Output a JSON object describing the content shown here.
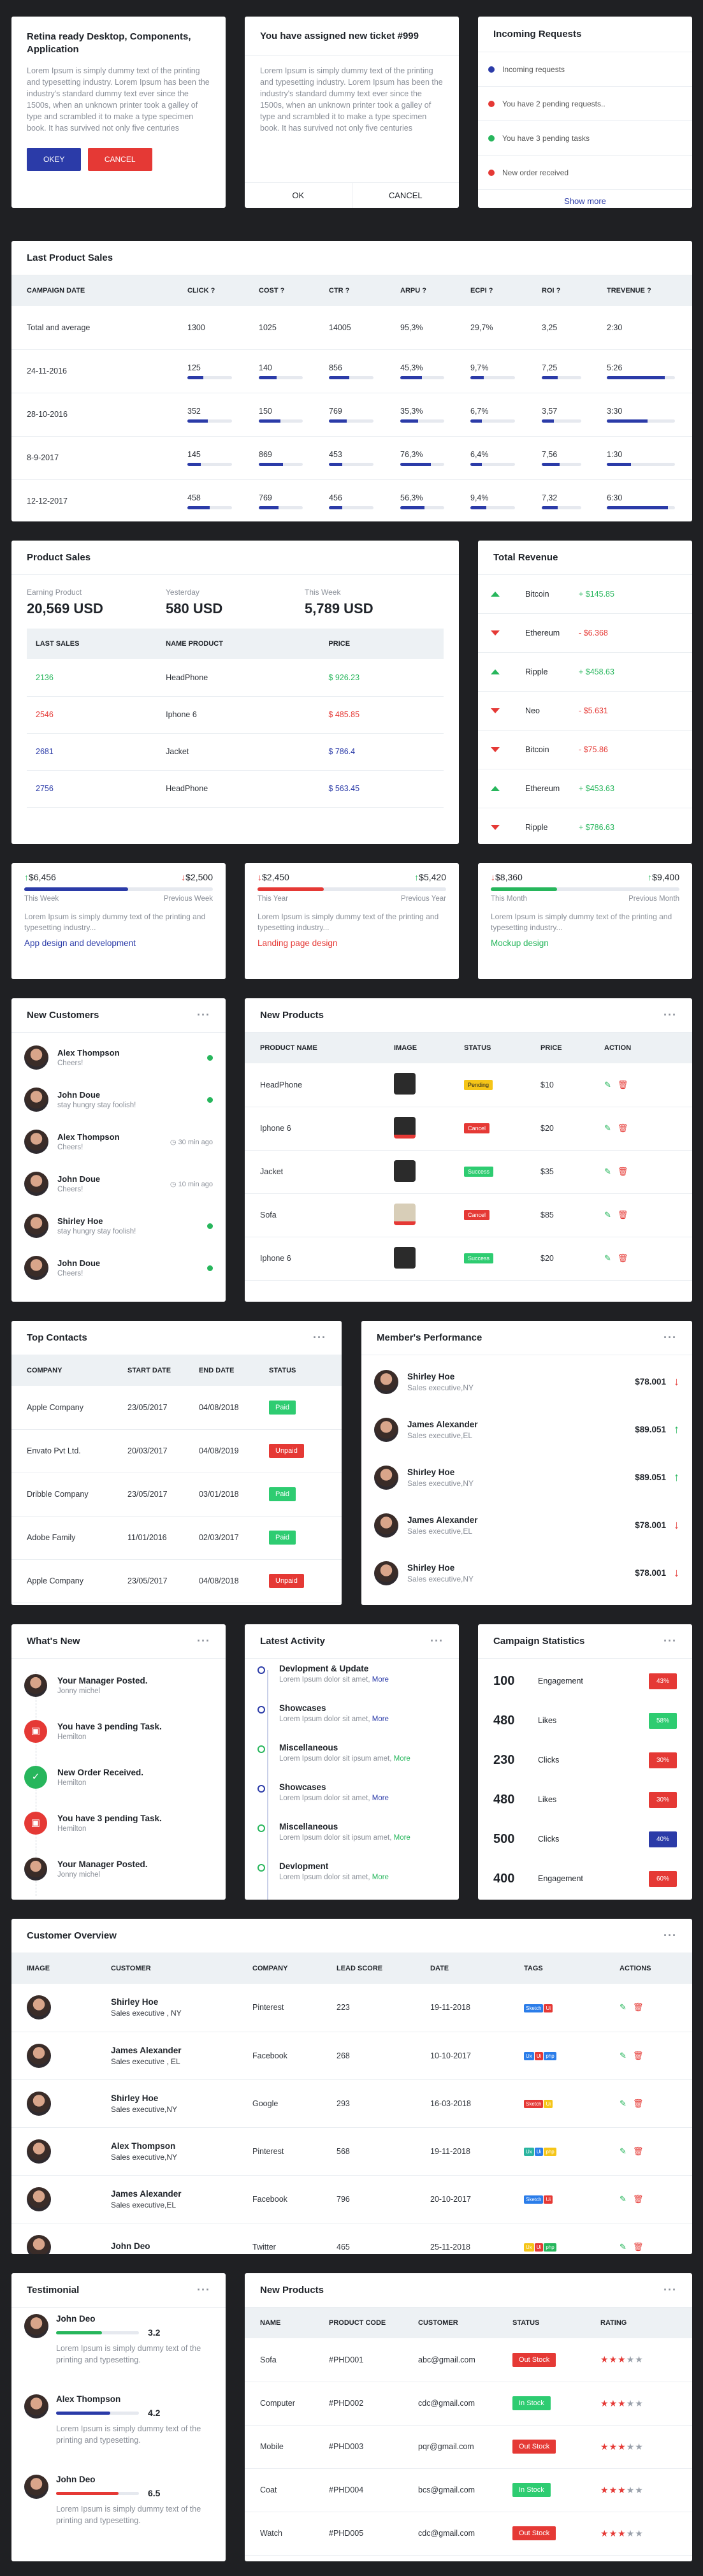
{
  "card1": {
    "title": "Retina ready Desktop, Components, Application",
    "body": "Lorem Ipsum is simply dummy text of the printing and typesetting industry. Lorem Ipsum has been the industry's standard dummy text ever since the 1500s, when an unknown printer took a galley of type and scrambled it to make a type specimen book. It has survived not only five centuries",
    "okay": "OKEY",
    "cancel": "CANCEL"
  },
  "card2": {
    "title": "You have assigned new ticket #999",
    "body": "Lorem Ipsum is simply dummy text of the printing and typesetting industry. Lorem Ipsum has been the industry's standard dummy text ever since the 1500s, when an unknown printer took a galley of type and scrambled it to make a type specimen book. It has survived not only five centuries",
    "ok": "OK",
    "cancel": "CANCEL"
  },
  "requests": {
    "title": "Incoming Requests",
    "items": [
      {
        "text": "Incoming requests",
        "color": "#2b3ba8"
      },
      {
        "text": "You have 2 pending requests..",
        "color": "#e53935"
      },
      {
        "text": "You have 3 pending tasks",
        "color": "#27b65c"
      },
      {
        "text": "New order received",
        "color": "#e53935"
      }
    ],
    "show_more": "Show more"
  },
  "last_sales": {
    "title": "Last Product Sales",
    "columns": [
      "CAMPAIGN DATE",
      "CLICK ?",
      "COST ?",
      "CTR ?",
      "ARPU ?",
      "ECPI ?",
      "ROI ?",
      "TREVENUE ?"
    ],
    "rows": [
      {
        "d": "Total and average",
        "v": [
          "1300",
          "1025",
          "14005",
          "95,3%",
          "29,7%",
          "3,25",
          "2:30"
        ],
        "bars": null
      },
      {
        "d": "24-11-2016",
        "v": [
          "125",
          "140",
          "856",
          "45,3%",
          "9,7%",
          "7,25",
          "5:26"
        ],
        "bars": [
          0.35,
          0.4,
          0.45,
          0.5,
          0.3,
          0.4,
          0.85
        ]
      },
      {
        "d": "28-10-2016",
        "v": [
          "352",
          "150",
          "769",
          "35,3%",
          "6,7%",
          "3,57",
          "3:30"
        ],
        "bars": [
          0.45,
          0.5,
          0.4,
          0.4,
          0.25,
          0.3,
          0.6
        ]
      },
      {
        "d": "8-9-2017",
        "v": [
          "145",
          "869",
          "453",
          "76,3%",
          "6,4%",
          "7,56",
          "1:30"
        ],
        "bars": [
          0.3,
          0.55,
          0.3,
          0.7,
          0.25,
          0.45,
          0.35
        ]
      },
      {
        "d": "12-12-2017",
        "v": [
          "458",
          "769",
          "456",
          "56,3%",
          "9,4%",
          "7,32",
          "6:30"
        ],
        "bars": [
          0.5,
          0.45,
          0.3,
          0.55,
          0.35,
          0.4,
          0.9
        ]
      }
    ]
  },
  "product_sales": {
    "title": "Product Sales",
    "stats": [
      {
        "label": "Earning Product",
        "value": "20,569 USD"
      },
      {
        "label": "Yesterday",
        "value": "580 USD"
      },
      {
        "label": "This Week",
        "value": "5,789 USD"
      }
    ],
    "columns": [
      "LAST SALES",
      "NAME PRODUCT",
      "PRICE"
    ],
    "rows": [
      {
        "id": "2136",
        "name": "HeadPhone",
        "price": "$ 926.23",
        "c": "green"
      },
      {
        "id": "2546",
        "name": "Iphone 6",
        "price": "$ 485.85",
        "c": "red"
      },
      {
        "id": "2681",
        "name": "Jacket",
        "price": "$ 786.4",
        "c": "blue"
      },
      {
        "id": "2756",
        "name": "HeadPhone",
        "price": "$ 563.45",
        "c": "blue"
      }
    ]
  },
  "revenue": {
    "title": "Total Revenue",
    "rows": [
      {
        "name": "Bitcoin",
        "val": "+ $145.85",
        "up": true
      },
      {
        "name": "Ethereum",
        "val": "- $6.368",
        "up": false
      },
      {
        "name": "Ripple",
        "val": "+ $458.63",
        "up": true
      },
      {
        "name": "Neo",
        "val": "- $5.631",
        "up": false
      },
      {
        "name": "Bitcoin",
        "val": "- $75.86",
        "up": false
      },
      {
        "name": "Ethereum",
        "val": "+ $453.63",
        "up": true
      },
      {
        "name": "Ripple",
        "val": "+ $786.63",
        "up": false
      }
    ]
  },
  "mini": [
    {
      "left": "$6,456",
      "right": "$2,500",
      "l_label": "This Week",
      "r_label": "Previous Week",
      "fill": 0.55,
      "color": "#2b3ba8",
      "body": "Lorem Ipsum is simply dummy text of the printing and typesetting industry...",
      "link": "App design and development",
      "lup": true
    },
    {
      "left": "$2,450",
      "right": "$5,420",
      "l_label": "This Year",
      "r_label": "Previous Year",
      "fill": 0.35,
      "color": "#e53935",
      "body": "Lorem Ipsum is simply dummy text of the printing and typesetting industry...",
      "link": "Landing page design",
      "lup": false
    },
    {
      "left": "$8,360",
      "right": "$9,400",
      "l_label": "This Month",
      "r_label": "Previous Month",
      "fill": 0.35,
      "color": "#27b65c",
      "body": "Lorem Ipsum is simply dummy text of the printing and typesetting industry...",
      "link": "Mockup design",
      "lup": false
    }
  ],
  "customers": {
    "title": "New Customers",
    "items": [
      {
        "name": "Alex Thompson",
        "sub": "Cheers!",
        "time": "",
        "online": true
      },
      {
        "name": "John Doue",
        "sub": "stay hungry stay foolish!",
        "time": "",
        "online": true
      },
      {
        "name": "Alex Thompson",
        "sub": "Cheers!",
        "time": "30 min ago",
        "online": false
      },
      {
        "name": "John Doue",
        "sub": "Cheers!",
        "time": "10 min ago",
        "online": false
      },
      {
        "name": "Shirley Hoe",
        "sub": "stay hungry stay foolish!",
        "time": "",
        "online": true
      },
      {
        "name": "John Doue",
        "sub": "Cheers!",
        "time": "",
        "online": true
      }
    ]
  },
  "new_products": {
    "title": "New Products",
    "columns": [
      "PRODUCT NAME",
      "IMAGE",
      "STATUS",
      "PRICE",
      "ACTION"
    ],
    "rows": [
      {
        "name": "HeadPhone",
        "status": "Pending",
        "cls": "bg-amber",
        "price": "$10"
      },
      {
        "name": "Iphone 6",
        "status": "Cancel",
        "cls": "bg-red",
        "price": "$20"
      },
      {
        "name": "Jacket",
        "status": "Success",
        "cls": "bg-green",
        "price": "$35"
      },
      {
        "name": "Sofa",
        "status": "Cancel",
        "cls": "bg-red",
        "price": "$85"
      },
      {
        "name": "Iphone 6",
        "status": "Success",
        "cls": "bg-green",
        "price": "$20"
      }
    ]
  },
  "contacts": {
    "title": "Top Contacts",
    "columns": [
      "COMPANY",
      "START DATE",
      "END DATE",
      "STATUS"
    ],
    "rows": [
      {
        "c": "Apple Company",
        "s": "23/05/2017",
        "e": "04/08/2018",
        "st": "Paid",
        "cls": "bg-green"
      },
      {
        "c": "Envato Pvt Ltd.",
        "s": "20/03/2017",
        "e": "04/08/2019",
        "st": "Unpaid",
        "cls": "bg-red"
      },
      {
        "c": "Dribble Company",
        "s": "23/05/2017",
        "e": "03/01/2018",
        "st": "Paid",
        "cls": "bg-green"
      },
      {
        "c": "Adobe Family",
        "s": "11/01/2016",
        "e": "02/03/2017",
        "st": "Paid",
        "cls": "bg-green"
      },
      {
        "c": "Apple Company",
        "s": "23/05/2017",
        "e": "04/08/2018",
        "st": "Unpaid",
        "cls": "bg-red"
      }
    ]
  },
  "performance": {
    "title": "Member's Performance",
    "items": [
      {
        "name": "Shirley Hoe",
        "sub": "Sales executive,NY",
        "val": "$78.001",
        "up": false
      },
      {
        "name": "James Alexander",
        "sub": "Sales executive,EL",
        "val": "$89.051",
        "up": true
      },
      {
        "name": "Shirley Hoe",
        "sub": "Sales executive,NY",
        "val": "$89.051",
        "up": true
      },
      {
        "name": "James Alexander",
        "sub": "Sales executive,EL",
        "val": "$78.001",
        "up": false
      },
      {
        "name": "Shirley Hoe",
        "sub": "Sales executive,NY",
        "val": "$78.001",
        "up": false
      }
    ]
  },
  "whatsnew": {
    "title": "What's New",
    "items": [
      {
        "t": "Your Manager Posted.",
        "s": "Jonny michel",
        "k": "av"
      },
      {
        "t": "You have 3 pending Task.",
        "s": "Hemilton",
        "k": "red"
      },
      {
        "t": "New Order Received.",
        "s": "Hemilton",
        "k": "green"
      },
      {
        "t": "You have 3 pending Task.",
        "s": "Hemilton",
        "k": "red"
      },
      {
        "t": "Your Manager Posted.",
        "s": "Jonny michel",
        "k": "av"
      }
    ]
  },
  "activity": {
    "title": "Latest Activity",
    "more": "More",
    "items": [
      {
        "t": "Devlopment & Update",
        "s": "Lorem Ipsum dolor sit amet,",
        "c": "#2b3ba8"
      },
      {
        "t": "Showcases",
        "s": "Lorem Ipsum dolor sit amet,",
        "c": "#2b3ba8"
      },
      {
        "t": "Miscellaneous",
        "s": "Lorem Ipsum dolor sit ipsum amet,",
        "c": "#27b65c"
      },
      {
        "t": "Showcases",
        "s": "Lorem Ipsum dolor sit amet,",
        "c": "#2b3ba8"
      },
      {
        "t": "Miscellaneous",
        "s": "Lorem Ipsum dolor sit ipsum amet,",
        "c": "#27b65c"
      },
      {
        "t": "Devlopment",
        "s": "Lorem Ipsum dolor sit amet,",
        "c": "#27b65c"
      }
    ]
  },
  "campaign": {
    "title": "Campaign Statistics",
    "rows": [
      {
        "n": "100",
        "l": "Engagement",
        "p": "43%",
        "cls": "bg-red"
      },
      {
        "n": "480",
        "l": "Likes",
        "p": "58%",
        "cls": "bg-green"
      },
      {
        "n": "230",
        "l": "Clicks",
        "p": "30%",
        "cls": "bg-red"
      },
      {
        "n": "480",
        "l": "Likes",
        "p": "30%",
        "cls": "bg-red"
      },
      {
        "n": "500",
        "l": "Clicks",
        "p": "40%",
        "cls": "bg-blue"
      },
      {
        "n": "400",
        "l": "Engagement",
        "p": "60%",
        "cls": "bg-red"
      }
    ]
  },
  "overview": {
    "title": "Customer Overview",
    "columns": [
      "IMAGE",
      "CUSTOMER",
      "COMPANY",
      "LEAD SCORE",
      "DATE",
      "TAGS",
      "ACTIONS"
    ],
    "rows": [
      {
        "n": "Shirley Hoe",
        "s": "Sales executive , NY",
        "co": "Pinterest",
        "sc": "223",
        "d": "19-11-2018",
        "tags": [
          [
            "Sketch",
            "#2b7de9"
          ],
          [
            "Ui",
            "#e53935"
          ]
        ]
      },
      {
        "n": "James Alexander",
        "s": "Sales executive , EL",
        "co": "Facebook",
        "sc": "268",
        "d": "10-10-2017",
        "tags": [
          [
            "Ux",
            "#2b7de9"
          ],
          [
            "Ui",
            "#e53935"
          ],
          [
            "php",
            "#2b7de9"
          ]
        ]
      },
      {
        "n": "Shirley Hoe",
        "s": "Sales executive,NY",
        "co": "Google",
        "sc": "293",
        "d": "16-03-2018",
        "tags": [
          [
            "Sketch",
            "#e53935"
          ],
          [
            "Ui",
            "#f5c518"
          ]
        ]
      },
      {
        "n": "Alex Thompson",
        "s": "Sales executive,NY",
        "co": "Pinterest",
        "sc": "568",
        "d": "19-11-2018",
        "tags": [
          [
            "Ux",
            "#2bb5a0"
          ],
          [
            "Ui",
            "#2b7de9"
          ],
          [
            "php",
            "#f5c518"
          ]
        ]
      },
      {
        "n": "James Alexander",
        "s": "Sales executive,EL",
        "co": "Facebook",
        "sc": "796",
        "d": "20-10-2017",
        "tags": [
          [
            "Sketch",
            "#2b7de9"
          ],
          [
            "Ui",
            "#e53935"
          ]
        ]
      },
      {
        "n": "John Deo",
        "s": "",
        "co": "Twitter",
        "sc": "465",
        "d": "25-11-2018",
        "tags": [
          [
            "Ux",
            "#f5c518"
          ],
          [
            "Ui",
            "#e53935"
          ],
          [
            "php",
            "#27b65c"
          ]
        ]
      }
    ]
  },
  "testimonial": {
    "title": "Testimonial",
    "items": [
      {
        "n": "John Deo",
        "v": "3.2",
        "fill": 0.55,
        "c": "#27b65c",
        "b": "Lorem Ipsum is simply dummy text of the printing and typesetting."
      },
      {
        "n": "Alex Thompson",
        "v": "4.2",
        "fill": 0.65,
        "c": "#2b3ba8",
        "b": "Lorem Ipsum is simply dummy text of the printing and typesetting."
      },
      {
        "n": "John Deo",
        "v": "6.5",
        "fill": 0.75,
        "c": "#e53935",
        "b": "Lorem Ipsum is simply dummy text of the printing and typesetting."
      }
    ]
  },
  "products2": {
    "title": "New Products",
    "columns": [
      "NAME",
      "PRODUCT CODE",
      "CUSTOMER",
      "STATUS",
      "RATING"
    ],
    "rows": [
      {
        "n": "Sofa",
        "c": "#PHD001",
        "e": "abc@gmail.com",
        "st": "Out Stock",
        "cls": "bg-red",
        "r": 3
      },
      {
        "n": "Computer",
        "c": "#PHD002",
        "e": "cdc@gmail.com",
        "st": "In Stock",
        "cls": "bg-green",
        "r": 3
      },
      {
        "n": "Mobile",
        "c": "#PHD003",
        "e": "pqr@gmail.com",
        "st": "Out Stock",
        "cls": "bg-red",
        "r": 3
      },
      {
        "n": "Coat",
        "c": "#PHD004",
        "e": "bcs@gmail.com",
        "st": "In Stock",
        "cls": "bg-green",
        "r": 3
      },
      {
        "n": "Watch",
        "c": "#PHD005",
        "e": "cdc@gmail.com",
        "st": "Out Stock",
        "cls": "bg-red",
        "r": 3
      }
    ]
  },
  "menu_dots": "···"
}
